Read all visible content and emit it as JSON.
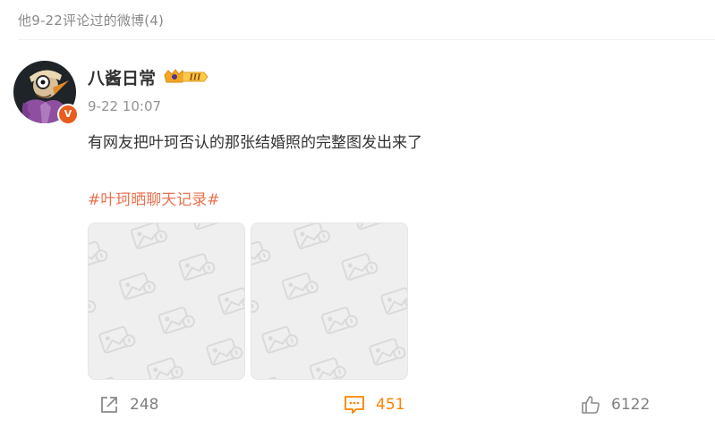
{
  "section": {
    "header": "他9-22评论过的微博(4)"
  },
  "post": {
    "author": {
      "name": "八酱日常",
      "avatar_icon": "cartoon-character-avatar",
      "verified_badge": "V",
      "verified_color": "#e85c1d",
      "member_badge": {
        "icon": "crown-icon",
        "level": "III",
        "color": "#f5a623"
      }
    },
    "time": "9-22 10:07",
    "text": "有网友把叶珂否认的那张结婚照的完整图发出来了",
    "topic": "#叶珂晒聊天记录#",
    "topic_color": "#eb7350",
    "images": [
      {
        "icon": "image-placeholder-icon"
      },
      {
        "icon": "image-placeholder-icon"
      }
    ],
    "actions": {
      "repost": {
        "icon": "share-icon",
        "count": "248"
      },
      "comment": {
        "icon": "comment-icon",
        "count": "451",
        "active_color": "#ff8200"
      },
      "like": {
        "icon": "thumbs-up-icon",
        "count": "6122"
      }
    }
  }
}
